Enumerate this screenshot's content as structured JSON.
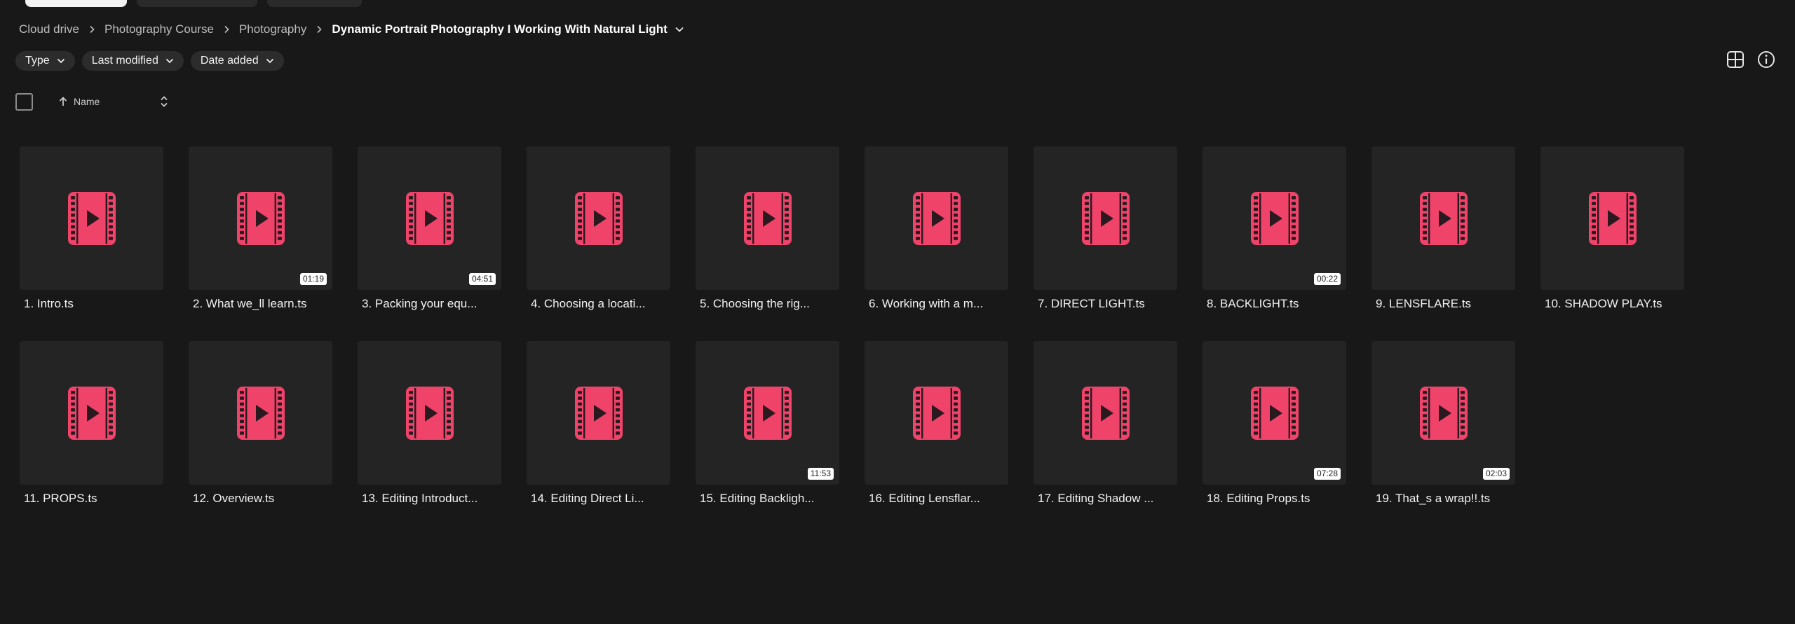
{
  "breadcrumb": {
    "items": [
      "Cloud drive",
      "Photography Course",
      "Photography"
    ],
    "current": "Dynamic Portrait Photography I Working With Natural Light"
  },
  "filters": {
    "type": "Type",
    "last_modified": "Last modified",
    "date_added": "Date added"
  },
  "sort": {
    "column": "Name"
  },
  "colors": {
    "accent": "#f0436a",
    "background": "#181818",
    "tile": "#242425"
  },
  "files": [
    {
      "name": "1. Intro.ts",
      "duration": ""
    },
    {
      "name": "2. What we_ll learn.ts",
      "duration": "01:19"
    },
    {
      "name": "3. Packing your equ...",
      "duration": "04:51"
    },
    {
      "name": "4. Choosing a locati...",
      "duration": ""
    },
    {
      "name": "5. Choosing the rig...",
      "duration": ""
    },
    {
      "name": "6. Working with a m...",
      "duration": ""
    },
    {
      "name": "7. DIRECT LIGHT.ts",
      "duration": ""
    },
    {
      "name": "8. BACKLIGHT.ts",
      "duration": "00:22"
    },
    {
      "name": "9. LENSFLARE.ts",
      "duration": ""
    },
    {
      "name": "10. SHADOW PLAY.ts",
      "duration": ""
    },
    {
      "name": "11. PROPS.ts",
      "duration": ""
    },
    {
      "name": "12. Overview.ts",
      "duration": ""
    },
    {
      "name": "13. Editing Introduct...",
      "duration": ""
    },
    {
      "name": "14. Editing Direct Li...",
      "duration": ""
    },
    {
      "name": "15. Editing Backligh...",
      "duration": "11:53"
    },
    {
      "name": "16. Editing Lensflar...",
      "duration": ""
    },
    {
      "name": "17. Editing Shadow ...",
      "duration": ""
    },
    {
      "name": "18. Editing Props.ts",
      "duration": "07:28"
    },
    {
      "name": "19. That_s a wrap!!.ts",
      "duration": "02:03"
    }
  ]
}
